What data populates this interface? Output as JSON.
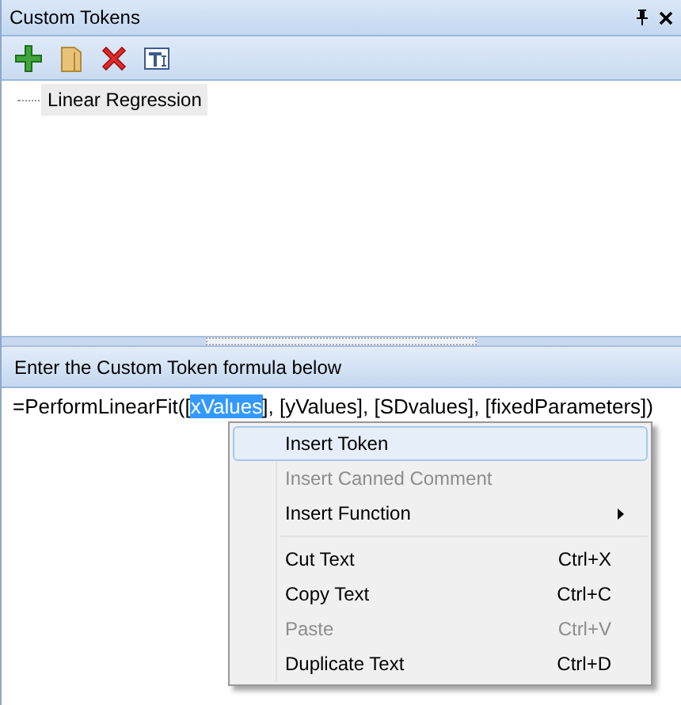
{
  "panel": {
    "title": "Custom Tokens"
  },
  "toolbar": [
    {
      "kind": "add"
    },
    {
      "kind": "folder"
    },
    {
      "kind": "delete"
    },
    {
      "kind": "text"
    }
  ],
  "tree": {
    "items": [
      {
        "label": "Linear Regression",
        "selected": true
      }
    ]
  },
  "formula": {
    "header": "Enter the Custom Token formula below",
    "before": "=PerformLinearFit([",
    "selection": "xValues",
    "after": "], [yValues], [SDvalues], [fixedParameters])"
  },
  "context_menu": [
    {
      "kind": "item",
      "label": "Insert Token",
      "disabled": false,
      "selected": true
    },
    {
      "kind": "item",
      "label": "Insert Canned Comment",
      "disabled": true,
      "selected": false
    },
    {
      "kind": "submenu",
      "label": "Insert Function",
      "disabled": false,
      "selected": false
    },
    {
      "kind": "separator"
    },
    {
      "kind": "item",
      "label": "Cut Text",
      "shortcut": "Ctrl+X",
      "disabled": false,
      "selected": false
    },
    {
      "kind": "item",
      "label": "Copy Text",
      "shortcut": "Ctrl+C",
      "disabled": false,
      "selected": false
    },
    {
      "kind": "item",
      "label": "Paste",
      "shortcut": "Ctrl+V",
      "disabled": true,
      "selected": false
    },
    {
      "kind": "item",
      "label": "Duplicate Text",
      "shortcut": "Ctrl+D",
      "disabled": false,
      "selected": false
    }
  ]
}
